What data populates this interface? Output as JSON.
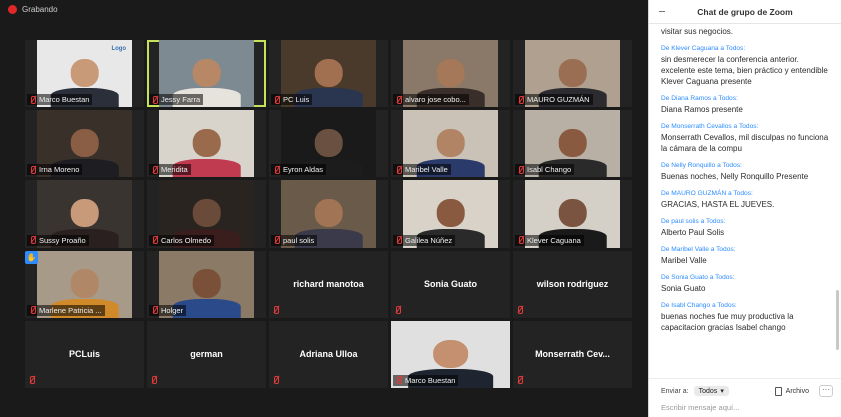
{
  "recording": {
    "label": "Grabando",
    "color": "#e02828"
  },
  "gallery": {
    "active_speaker_color": "#c5e25a",
    "tiles": [
      {
        "name": "Marco Buestan",
        "video": true,
        "bg": "#e8e8e8",
        "skin": "#c89a78",
        "body": "#2a2f3a",
        "logo": "Logo"
      },
      {
        "name": "Jessy Farra",
        "video": true,
        "bg": "#7e8a92",
        "skin": "#b88866",
        "body": "#e6e2dc",
        "active": true
      },
      {
        "name": "PC Luis",
        "video": true,
        "bg": "#4a3a2c",
        "skin": "#a07050",
        "body": "#2a3550"
      },
      {
        "name": "alvaro jose cobo...",
        "video": true,
        "bg": "#8a7868",
        "skin": "#a47858",
        "body": "#3a2e2a"
      },
      {
        "name": "MAURO GUZMÁN",
        "video": true,
        "bg": "#b0a090",
        "skin": "#9a6e52",
        "body": "#2c2c30"
      },
      {
        "name": "Irna Moreno",
        "video": true,
        "bg": "#3a302a",
        "skin": "#8a5e44",
        "body": "#1e1e22"
      },
      {
        "name": "Meridita",
        "video": true,
        "bg": "#d8d4cc",
        "skin": "#9a6a4c",
        "body": "#c03a50"
      },
      {
        "name": "Eyron Aldas",
        "video": true,
        "bg": "#1a1a1a",
        "skin": "#6a5040",
        "body": "#1c1c1c"
      },
      {
        "name": "Maribel Valle",
        "video": true,
        "bg": "#cac2b6",
        "skin": "#b08464",
        "body": "#2a3a6a"
      },
      {
        "name": "Isabl Chango",
        "video": true,
        "bg": "#b8b0a4",
        "skin": "#8a5a40",
        "body": "#2a2a2a"
      },
      {
        "name": "Sussy Proaño",
        "video": true,
        "bg": "#3a3430",
        "skin": "#c89a7a",
        "body": "#2a2020"
      },
      {
        "name": "Carlos Olmedo",
        "video": true,
        "bg": "#2a2420",
        "skin": "#6a4a38",
        "body": "#3a1e1e"
      },
      {
        "name": "paul solis",
        "video": true,
        "bg": "#6a5a4a",
        "skin": "#a07454",
        "body": "#3a3a4a"
      },
      {
        "name": "Galilea Núñez",
        "video": true,
        "bg": "#d8d2c8",
        "skin": "#8a5a40",
        "body": "#2a2a2a"
      },
      {
        "name": "Klever Caguana",
        "video": true,
        "bg": "#d4d0c8",
        "skin": "#7a5440",
        "body": "#1a1a1a"
      },
      {
        "name": "Marlene Patricia ...",
        "video": true,
        "bg": "#a89a88",
        "skin": "#b08868",
        "body": "#d08a2a",
        "hand": true
      },
      {
        "name": "Holger",
        "video": true,
        "bg": "#8a7a66",
        "skin": "#7a5038",
        "body": "#2a4a8a"
      },
      {
        "name": "richard manotoa",
        "video": false
      },
      {
        "name": "Sonia Guato",
        "video": false
      },
      {
        "name": "wilson rodriguez",
        "video": false
      },
      {
        "name": "PCLuis",
        "video": false
      },
      {
        "name": "german",
        "video": false
      },
      {
        "name": "Adriana Ulloa",
        "video": false
      },
      {
        "name": "Marco Buestan",
        "video": true,
        "bg": "#e0e0e0",
        "skin": "#c49070",
        "body": "#1e2430",
        "full": true
      },
      {
        "name": "Monserrath Cev...",
        "video": false
      }
    ]
  },
  "chat": {
    "title": "Chat de grupo de Zoom",
    "messages": [
      {
        "from": "",
        "text": "visitar sus negocios."
      },
      {
        "from": "De Klever Caguana a Todos:",
        "text": "sin desmerecer la conferencia anterior. excelente este tema, bien práctico y entendible\nKlever Caguana presente"
      },
      {
        "from": "De Diana Ramos a Todos:",
        "text": "Diana Ramos presente"
      },
      {
        "from": "De Monserrath Cevallos a Todos:",
        "text": "Monserrath Cevallos, mil disculpas no funciona la cámara de la compu"
      },
      {
        "from": "De Nelly Ronquillo a Todos:",
        "text": "Buenas noches, Nelly Ronquillo Presente"
      },
      {
        "from": "De MAURO GUZMÁN a Todos:",
        "text": "GRACIAS, HASTA EL  JUEVES."
      },
      {
        "from": "De paul solis a Todos:",
        "text": "Alberto Paul Solis"
      },
      {
        "from": "De Maribel Valle a Todos:",
        "text": "Maribel Valle"
      },
      {
        "from": "De Sonia Guato a Todos:",
        "text": "Sonia Guato"
      },
      {
        "from": "De Isabl Chango a Todos:",
        "text": "buenas noches fue muy productiva la capacitacion gracias Isabel chango"
      }
    ],
    "send_to_label": "Enviar a:",
    "send_to_value": "Todos",
    "file_label": "Archivo",
    "more_label": "···",
    "input_placeholder": "Escribir mensaje aquí..."
  }
}
